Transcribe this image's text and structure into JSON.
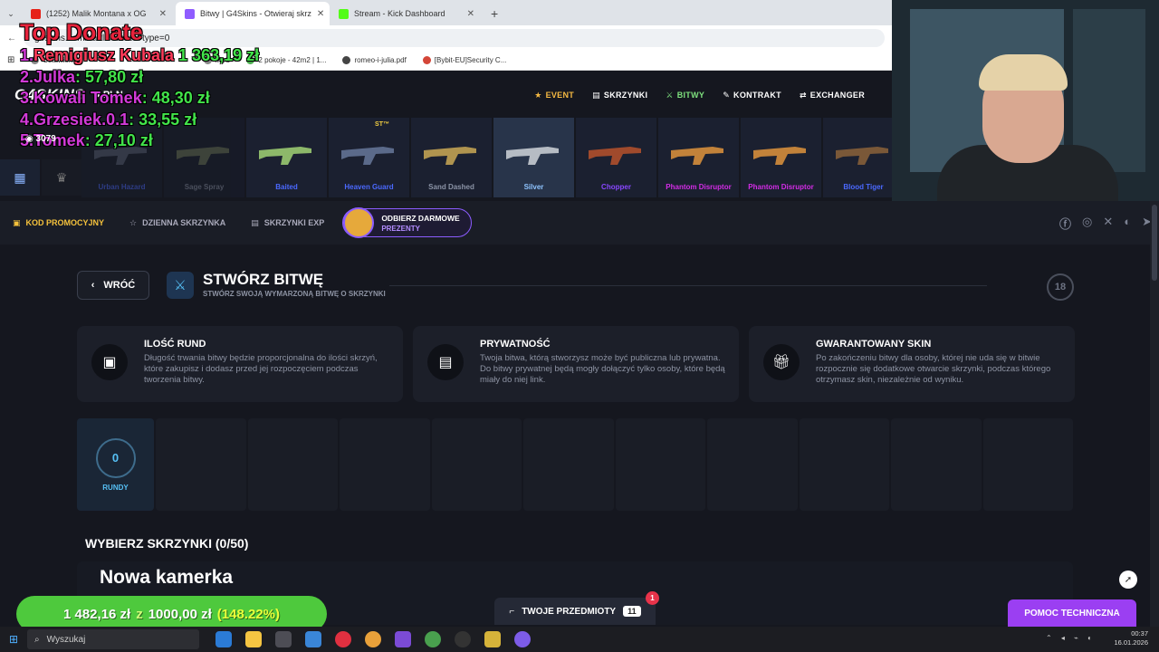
{
  "browser": {
    "tabs": [
      {
        "label": "(1252) Malik Montana x OG",
        "favicon_color": "#e62117"
      },
      {
        "label": "Bitwy | G4Skins - Otwieraj skrz",
        "favicon_color": "#8f5cff"
      },
      {
        "label": "Stream - Kick Dashboard",
        "favicon_color": "#53fc18"
      }
    ],
    "new_tab": "+",
    "url": "g4skins.com/battle/create?type=0",
    "bookmarks": [
      "Ustawienia",
      "MoC",
      "2 pokoje - 42m2 | 1...",
      "romeo-i-julia.pdf",
      "[Bybit-EU]Security C..."
    ]
  },
  "site": {
    "logo": "G4SKINS",
    "currency": "PLN",
    "balance": "3079",
    "nav": [
      {
        "label": "EVENT",
        "icon": "star-icon"
      },
      {
        "label": "SKRZYNKI",
        "icon": "boxes-icon"
      },
      {
        "label": "BITWY",
        "icon": "swords-icon"
      },
      {
        "label": "KONTRAKT",
        "icon": "pen-icon"
      },
      {
        "label": "EXCHANGER",
        "icon": "exchange-icon"
      }
    ],
    "cases": [
      {
        "name": "Urban Hazard",
        "color": "#4b69ff",
        "gun_color": "#5a6478"
      },
      {
        "name": "Sage Spray",
        "color": "#8b93a6",
        "gun_color": "#6f7a5c"
      },
      {
        "name": "Baited",
        "color": "#4b69ff",
        "gun_color": "#8db86a"
      },
      {
        "name": "Heaven Guard",
        "color": "#4b69ff",
        "gun_color": "#5b6a8a",
        "badge": "ST™"
      },
      {
        "name": "Sand Dashed",
        "color": "#8b93a6",
        "gun_color": "#b0944f"
      },
      {
        "name": "Silver",
        "color": "#8fc4ff",
        "gun_color": "#b6bcc4"
      },
      {
        "name": "Chopper",
        "color": "#8847ff",
        "gun_color": "#a04a2c"
      },
      {
        "name": "Phantom Disruptor",
        "color": "#d32ce6",
        "gun_color": "#c2823a"
      },
      {
        "name": "Phantom Disruptor",
        "color": "#d32ce6",
        "gun_color": "#c2823a"
      },
      {
        "name": "Blood Tiger",
        "color": "#4b69ff",
        "gun_color": "#7a5838"
      }
    ],
    "subnav": {
      "promo": "KOD PROMOCYJNY",
      "daily": "DZIENNA SKRZYNKA",
      "exp": "SKRZYNKI EXP",
      "free_title": "ODBIERZ DARMOWE",
      "free_sub": "PREZENTY"
    }
  },
  "battle": {
    "back": "WRÓĆ",
    "title": "STWÓRZ BITWĘ",
    "subtitle": "STWÓRZ SWOJĄ WYMARZONĄ BITWĘ O SKRZYNKI",
    "age": "18",
    "cards": [
      {
        "title": "ILOŚĆ RUND",
        "icon": "box-icon",
        "text": "Długość trwania bitwy będzie proporcjonalna do ilości skrzyń, które zakupisz i dodasz przed jej rozpoczęciem podczas tworzenia bitwy."
      },
      {
        "title": "PRYWATNOŚĆ",
        "icon": "document-icon",
        "text": "Twoja bitwa, którą stworzysz może być publiczna lub prywatna. Do bitwy prywatnej będą mogły dołączyć tylko osoby, które będą miały do niej link."
      },
      {
        "title": "GWARANTOWANY SKIN",
        "icon": "gift-icon",
        "text": "Po zakończeniu bitwy dla osoby, której nie uda się w bitwie rozpocznie się dodatkowe otwarcie skrzynki, podczas którego otrzymasz skin, niezależnie od wyniku."
      }
    ],
    "rounds_value": "0",
    "rounds_label": "RUNDY",
    "choose_label": "WYBIERZ SKRZYNKI (0/50)",
    "items_label": "TWOJE PRZEDMIOTY",
    "items_count": "11",
    "items_badge": "1",
    "help_label": "POMOC TECHNICZNA"
  },
  "overlay": {
    "donate_title": "Top Donate",
    "donors": [
      {
        "rank": "1.",
        "name": "Remigiusz Kubala",
        "amount": "1 363,19 zł"
      },
      {
        "rank": "2.",
        "name": "Julka",
        "amount": ": 57,80 zł"
      },
      {
        "rank": "3.",
        "name": "Kowali Tomek",
        "amount": ": 48,30 zł"
      },
      {
        "rank": "4.",
        "name": "Grzesiek.0.1",
        "amount": ": 33,55 zł"
      },
      {
        "rank": "5.",
        "name": "Tomek",
        "amount": ": 27,10 zł"
      }
    ],
    "camera_label": "Nowa kamerka",
    "goal_current": "1 482,16 zł",
    "goal_sep": "z",
    "goal_target": "1000,00 zł",
    "goal_pct": "(148.22%)"
  },
  "taskbar": {
    "search": "Wyszukaj",
    "time": "00:37",
    "date": "16.01.2026"
  }
}
